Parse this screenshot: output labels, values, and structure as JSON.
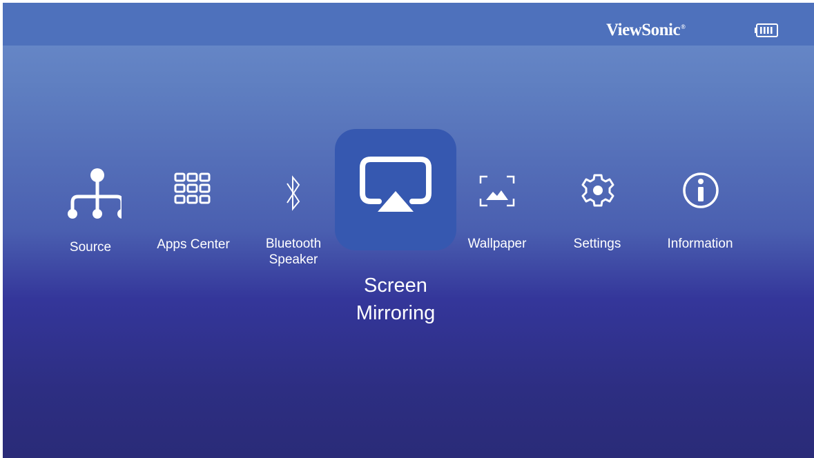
{
  "header": {
    "brand": "ViewSonic",
    "brand_mark": "®",
    "battery_icon": "battery-full-icon"
  },
  "menu": {
    "selected": "Screen Mirroring",
    "items": [
      {
        "label": "Source",
        "icon": "source-tree-icon"
      },
      {
        "label": "Apps Center",
        "icon": "apps-grid-icon"
      },
      {
        "label": "Bluetooth",
        "label2": "Speaker",
        "icon": "bluetooth-icon"
      },
      {
        "label": "Screen",
        "label2": "Mirroring",
        "icon": "screen-mirroring-icon"
      },
      {
        "label": "Wallpaper",
        "icon": "wallpaper-icon"
      },
      {
        "label": "Settings",
        "icon": "gear-icon"
      },
      {
        "label": "Information",
        "icon": "info-icon"
      }
    ]
  },
  "colors": {
    "top_bar": "#4e71bc",
    "selected_tile": "#3658b0",
    "background_top": "#6c8dcb",
    "background_bottom": "#2a2b78"
  }
}
